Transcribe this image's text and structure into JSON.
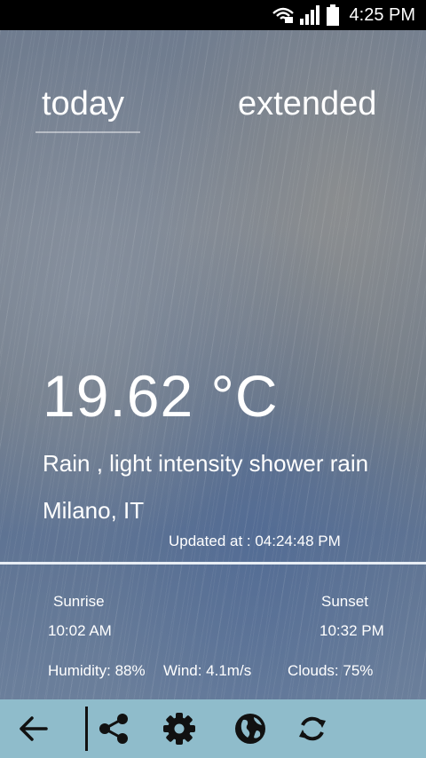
{
  "status_bar": {
    "time": "4:25 PM",
    "icons": [
      "wifi-icon",
      "signal-icon",
      "battery-icon"
    ]
  },
  "tabs": [
    {
      "label": "today",
      "selected": true
    },
    {
      "label": "extended",
      "selected": false
    }
  ],
  "weather": {
    "temperature": "19.62 °C",
    "description": "Rain , light intensity shower rain",
    "location": "Milano, IT",
    "updated": "Updated at : 04:24:48 PM"
  },
  "sun": {
    "sunrise_label": "Sunrise",
    "sunrise_time": "10:02 AM",
    "sunset_label": "Sunset",
    "sunset_time": "10:32 PM"
  },
  "stats": {
    "humidity": "Humidity: 88%",
    "wind": "Wind: 4.1m/s",
    "clouds": "Clouds: 75%"
  },
  "toolbar": {
    "icons": [
      "back-arrow-icon",
      "share-icon",
      "settings-gear-icon",
      "globe-icon",
      "refresh-icon"
    ],
    "background": "#8fbccb"
  }
}
